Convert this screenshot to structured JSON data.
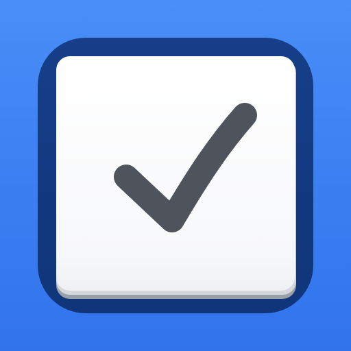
{
  "icon": {
    "name": "checkbox-app-icon",
    "glyph": "check-icon",
    "colors": {
      "background_top": "#4a8ef8",
      "background_bottom": "#3273ec",
      "frame": "#133a80",
      "card": "#ffffff",
      "card_shadow": "#d8dbe0",
      "check": "#4f545c"
    }
  }
}
